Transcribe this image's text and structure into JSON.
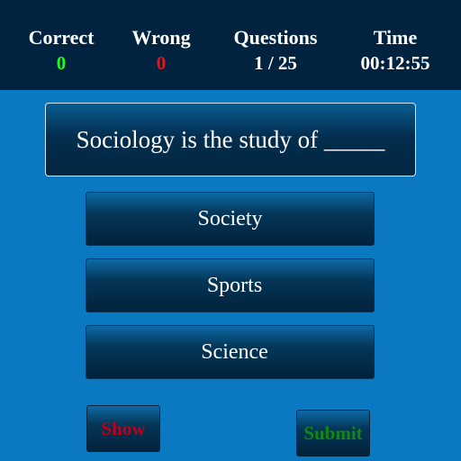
{
  "stats": {
    "correct": {
      "label": "Correct",
      "value": "0"
    },
    "wrong": {
      "label": "Wrong",
      "value": "0"
    },
    "questions": {
      "label": "Questions",
      "value": "1 / 25"
    },
    "time": {
      "label": "Time",
      "value": "00:12:55"
    }
  },
  "question": {
    "text": "Sociology is the study of _____"
  },
  "options": [
    {
      "label": "Society"
    },
    {
      "label": "Sports"
    },
    {
      "label": "Science"
    }
  ],
  "actions": {
    "show_label": "Show",
    "submit_label": "Submit"
  },
  "colors": {
    "background": "#0b78c2",
    "header": "#012340",
    "correct": "#1aff1a",
    "wrong": "#e8141a",
    "show": "#c0001a",
    "submit": "#0e8a14"
  }
}
